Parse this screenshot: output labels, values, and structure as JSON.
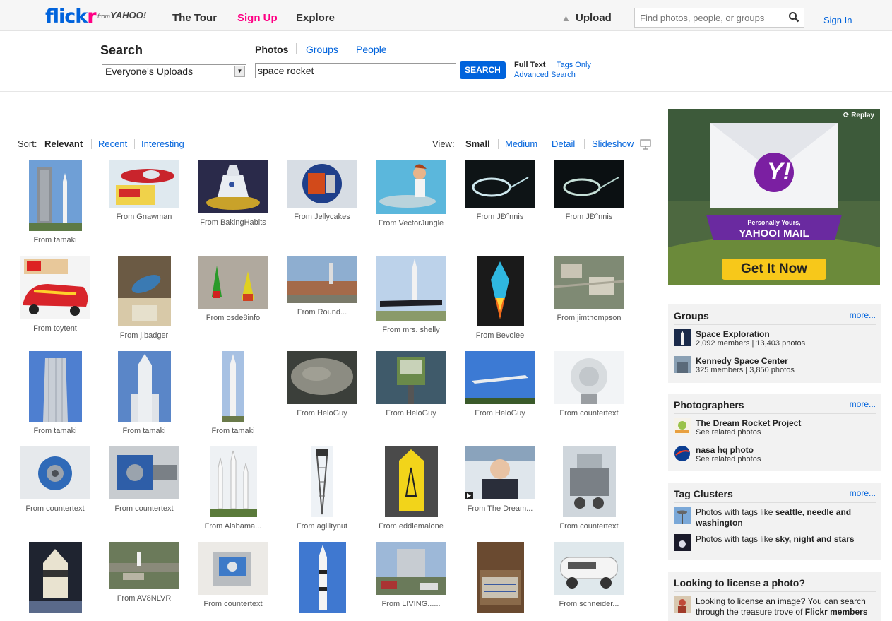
{
  "header": {
    "logo_main": "flickr",
    "logo_from": "from",
    "logo_yahoo": "YAHOO!",
    "nav": {
      "tour": "The Tour",
      "signup": "Sign Up",
      "explore": "Explore"
    },
    "upload": "Upload",
    "search_placeholder": "Find photos, people, or groups",
    "signin": "Sign In"
  },
  "search": {
    "heading": "Search",
    "scope_selected": "Everyone's Uploads",
    "tabs": {
      "photos": "Photos",
      "groups": "Groups",
      "people": "People"
    },
    "query": "space rocket",
    "button": "SEARCH",
    "full_text": "Full Text",
    "tags_only": "Tags Only",
    "advanced": "Advanced Search"
  },
  "sort": {
    "label": "Sort:",
    "relevant": "Relevant",
    "recent": "Recent",
    "interesting": "Interesting"
  },
  "view": {
    "label": "View:",
    "small": "Small",
    "medium": "Medium",
    "detail": "Detail",
    "slideshow": "Slideshow"
  },
  "photos": [
    {
      "caption": "From tamaki"
    },
    {
      "caption": "From Gnawman"
    },
    {
      "caption": "From BakingHabits"
    },
    {
      "caption": "From Jellycakes"
    },
    {
      "caption": "From VectorJungle"
    },
    {
      "caption": "From JĐ°nnis"
    },
    {
      "caption": "From JĐ°nnis"
    },
    {
      "caption": "From toytent"
    },
    {
      "caption": "From j.badger"
    },
    {
      "caption": "From osde8info"
    },
    {
      "caption": "From Round..."
    },
    {
      "caption": "From mrs. shelly"
    },
    {
      "caption": "From Bevolee"
    },
    {
      "caption": "From jimthompson"
    },
    {
      "caption": "From tamaki"
    },
    {
      "caption": "From tamaki"
    },
    {
      "caption": "From tamaki"
    },
    {
      "caption": "From HeloGuy"
    },
    {
      "caption": "From HeloGuy"
    },
    {
      "caption": "From HeloGuy"
    },
    {
      "caption": "From countertext"
    },
    {
      "caption": "From countertext"
    },
    {
      "caption": "From countertext"
    },
    {
      "caption": "From Alabama..."
    },
    {
      "caption": "From agilitynut"
    },
    {
      "caption": "From eddiemalone"
    },
    {
      "caption": "From The Dream..."
    },
    {
      "caption": "From countertext"
    },
    {
      "caption": ""
    },
    {
      "caption": "From AV8NLVR"
    },
    {
      "caption": "From countertext"
    },
    {
      "caption": ""
    },
    {
      "caption": "From LIVING......"
    },
    {
      "caption": ""
    },
    {
      "caption": "From schneider..."
    }
  ],
  "ad": {
    "replay": "Replay",
    "tagline": "Personally Yours,",
    "brand": "YAHOO! MAIL",
    "cta": "Get It Now"
  },
  "groups": {
    "title": "Groups",
    "more": "more...",
    "items": [
      {
        "name": "Space Exploration",
        "meta": "2,092 members | 13,403 photos"
      },
      {
        "name": "Kennedy Space Center",
        "meta": "325 members | 3,850 photos"
      }
    ]
  },
  "photographers": {
    "title": "Photographers",
    "more": "more...",
    "items": [
      {
        "name": "The Dream Rocket Project",
        "meta": "See related photos"
      },
      {
        "name": "nasa hq photo",
        "meta": "See related photos"
      }
    ]
  },
  "tagclusters": {
    "title": "Tag Clusters",
    "more": "more...",
    "items": [
      {
        "prefix": "Photos with tags like ",
        "tags": "seattle, needle and washington"
      },
      {
        "prefix": "Photos with tags like ",
        "tags": "sky, night and stars"
      }
    ]
  },
  "license": {
    "title": "Looking to license a photo?",
    "text": "Looking to license an image? You can search through the treasure trove of",
    "bold": "Flickr members"
  },
  "colors": {
    "flickr_blue": "#0063dc",
    "flickr_pink": "#ff0084"
  }
}
